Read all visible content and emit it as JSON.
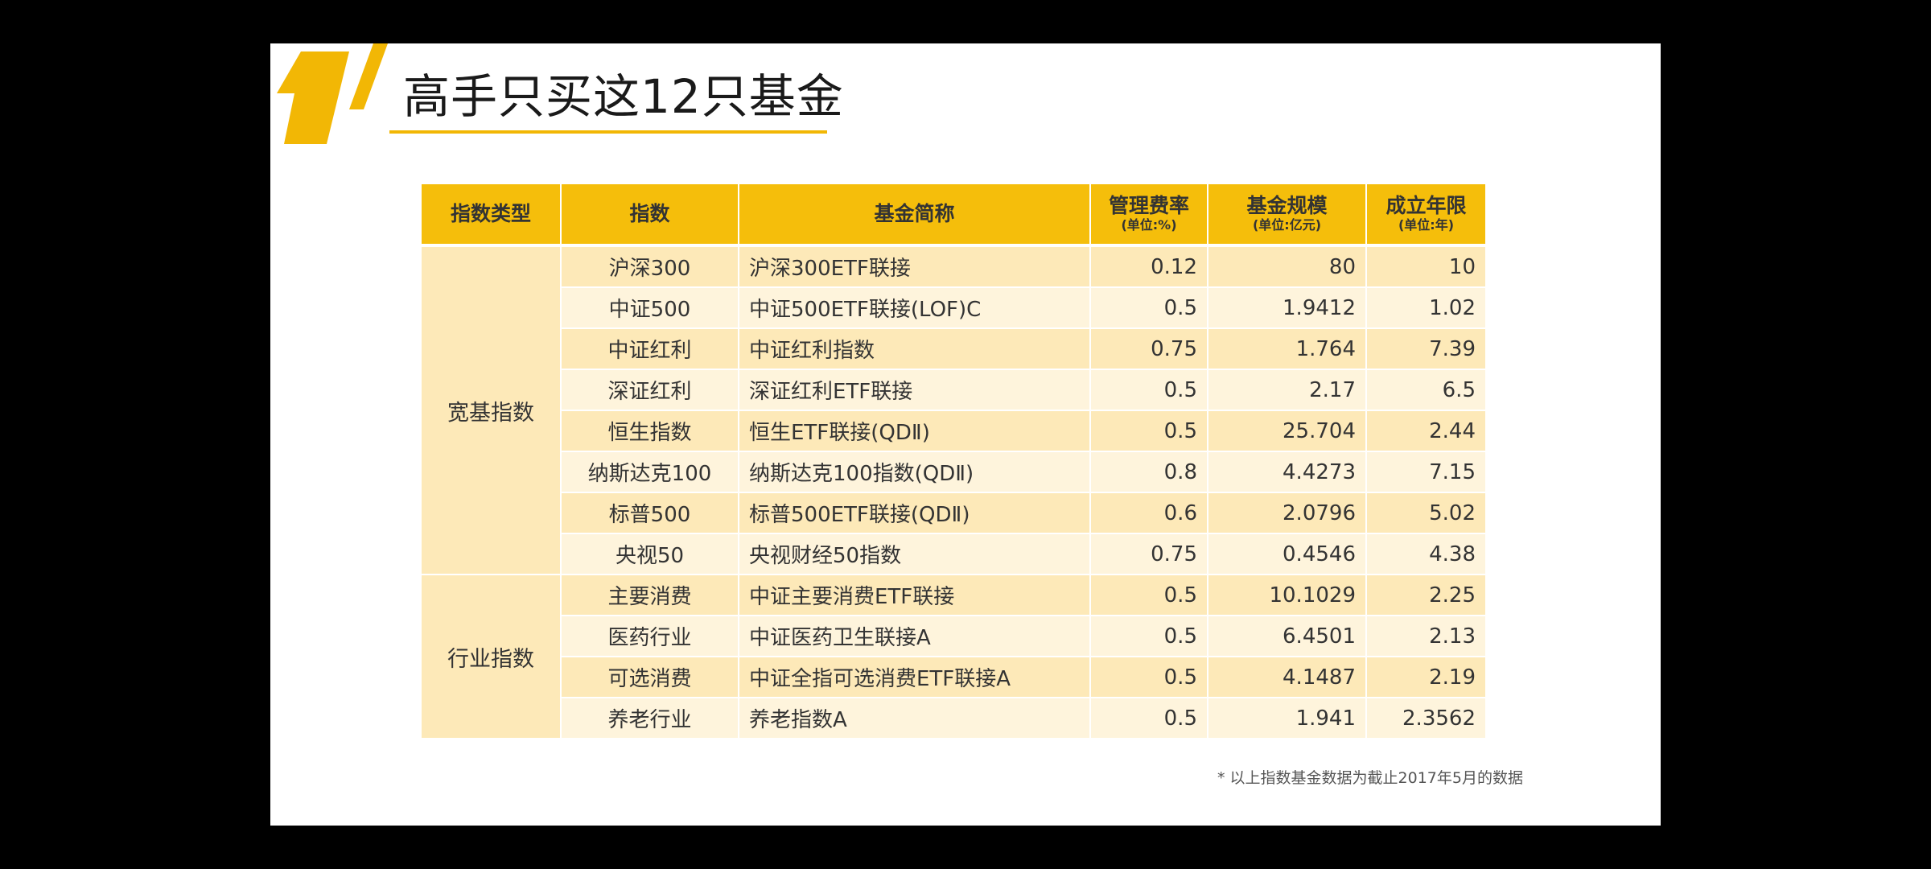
{
  "slide": {
    "title": "高手只买这12只基金",
    "footnote": "* 以上指数基金数据为截止2017年5月的数据"
  },
  "colors": {
    "accent": "#f5be0b",
    "row_dark": "#fde9b8",
    "row_light": "#fef4dc"
  },
  "table": {
    "headers": {
      "type": "指数类型",
      "index": "指数",
      "fund": "基金简称",
      "fee": "管理费率",
      "fee_unit": "(单位:%)",
      "scale": "基金规模",
      "scale_unit": "(单位:亿元)",
      "years": "成立年限",
      "years_unit": "(单位:年)"
    },
    "categories": {
      "broad": "宽基指数",
      "industry": "行业指数"
    },
    "rows": [
      {
        "index": "沪深300",
        "fund": "沪深300ETF联接",
        "fee": "0.12",
        "scale": "80",
        "years": "10"
      },
      {
        "index": "中证500",
        "fund": "中证500ETF联接(LOF)C",
        "fee": "0.5",
        "scale": "1.9412",
        "years": "1.02"
      },
      {
        "index": "中证红利",
        "fund": "中证红利指数",
        "fee": "0.75",
        "scale": "1.764",
        "years": "7.39"
      },
      {
        "index": "深证红利",
        "fund": "深证红利ETF联接",
        "fee": "0.5",
        "scale": "2.17",
        "years": "6.5"
      },
      {
        "index": "恒生指数",
        "fund": "恒生ETF联接(QDⅡ)",
        "fee": "0.5",
        "scale": "25.704",
        "years": "2.44"
      },
      {
        "index": "纳斯达克100",
        "fund": "纳斯达克100指数(QDⅡ)",
        "fee": "0.8",
        "scale": "4.4273",
        "years": "7.15"
      },
      {
        "index": "标普500",
        "fund": "标普500ETF联接(QDⅡ)",
        "fee": "0.6",
        "scale": "2.0796",
        "years": "5.02"
      },
      {
        "index": "央视50",
        "fund": "央视财经50指数",
        "fee": "0.75",
        "scale": "0.4546",
        "years": "4.38"
      },
      {
        "index": "主要消费",
        "fund": "中证主要消费ETF联接",
        "fee": "0.5",
        "scale": "10.1029",
        "years": "2.25"
      },
      {
        "index": "医药行业",
        "fund": "中证医药卫生联接A",
        "fee": "0.5",
        "scale": "6.4501",
        "years": "2.13"
      },
      {
        "index": "可选消费",
        "fund": "中证全指可选消费ETF联接A",
        "fee": "0.5",
        "scale": "4.1487",
        "years": "2.19"
      },
      {
        "index": "养老行业",
        "fund": "养老指数A",
        "fee": "0.5",
        "scale": "1.941",
        "years": "2.3562"
      }
    ]
  }
}
